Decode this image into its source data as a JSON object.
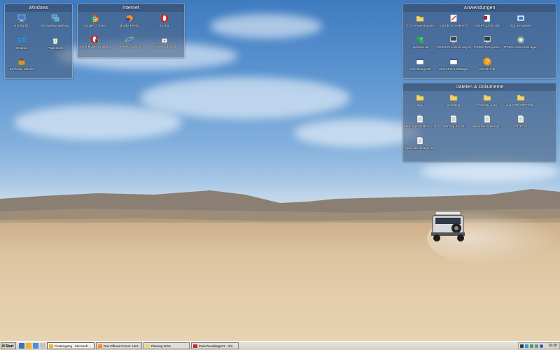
{
  "fences": {
    "windows": {
      "title": "Windows",
      "items": [
        {
          "label": "Arbeitsplatz",
          "icon": "computer-icon"
        },
        {
          "label": "Netzwerkumgebung",
          "icon": "network-icon"
        },
        {
          "label": "Dropbox",
          "icon": "dropbox-icon"
        },
        {
          "label": "Papierkorb",
          "icon": "recycle-bin-icon"
        },
        {
          "label": "Briefcase Classic",
          "icon": "briefcase-icon"
        }
      ]
    },
    "internet": {
      "title": "Internet",
      "items": [
        {
          "label": "Google Chrome",
          "icon": "chrome-icon"
        },
        {
          "label": "Mozilla Firefox",
          "icon": "firefox-icon"
        },
        {
          "label": "Opera",
          "icon": "opera-icon"
        },
        {
          "label": "Opera Mobile Emulator",
          "icon": "opera-mobile-icon"
        },
        {
          "label": "Internet Explorer",
          "icon": "ie-icon"
        },
        {
          "label": "PasswordDepot",
          "icon": "password-depot-icon"
        }
      ]
    },
    "anwendungen": {
      "title": "Anwendungen",
      "items": [
        {
          "label": "GTU-Anwendungen",
          "icon": "folder-icon"
        },
        {
          "label": "EQUIB-Schreibrecht",
          "icon": "app-icon"
        },
        {
          "label": "MSHProdDB.mdb",
          "icon": "access-db-icon"
        },
        {
          "label": "SQL-Entwickler",
          "icon": "sql-icon"
        },
        {
          "label": "UpdateSuite",
          "icon": "update-icon"
        },
        {
          "label": "ORBIS Produktionssystem",
          "icon": "orbis-icon"
        },
        {
          "label": "ORBIS Testsystem",
          "icon": "orbis-test-icon"
        },
        {
          "label": "ITSM Incident Management",
          "icon": "itsm-icon"
        },
        {
          "label": "AnmeldungASP",
          "icon": "window-icon"
        },
        {
          "label": "CheckPoint Manager",
          "icon": "window-icon"
        },
        {
          "label": "DocTTHelp",
          "icon": "help-icon"
        }
      ]
    },
    "dateien": {
      "title": "Dateien & Dokumente",
      "items": [
        {
          "label": "SQL",
          "icon": "folder-icon"
        },
        {
          "label": "Schulung",
          "icon": "folder-icon"
        },
        {
          "label": "Planung 2014",
          "icon": "folder-icon"
        },
        {
          "label": "2014-Website-Rela...",
          "icon": "folder-icon"
        },
        {
          "label": "Wartung EQUIB ä.Á.txt",
          "icon": "text-file-icon"
        },
        {
          "label": "Wartung ä.Á.txt",
          "icon": "text-file-icon"
        },
        {
          "label": "Windows-Systempr...",
          "icon": "text-file-icon"
        },
        {
          "label": "GTUC.txt",
          "icon": "text-file-icon"
        },
        {
          "label": "equib-aktivanlage-la...",
          "icon": "text-file-icon"
        }
      ]
    }
  },
  "taskbar": {
    "start_label": "Start",
    "tasks": [
      {
        "label": "Posteingang - Microsoft ...",
        "icon": "outlook-icon"
      },
      {
        "label": "Das Offroad Forum: Hint...",
        "icon": "browser-icon"
      },
      {
        "label": "Planung 2014",
        "icon": "folder-icon"
      },
      {
        "label": "Zwischenablage01 - Irfa...",
        "icon": "irfanview-icon"
      }
    ],
    "clock": "16:20"
  },
  "colors": {
    "fence_bg": "#465a78",
    "sky_top": "#3f7bc0",
    "sand": "#e4cdab",
    "taskbar": "#d4d0c8"
  }
}
